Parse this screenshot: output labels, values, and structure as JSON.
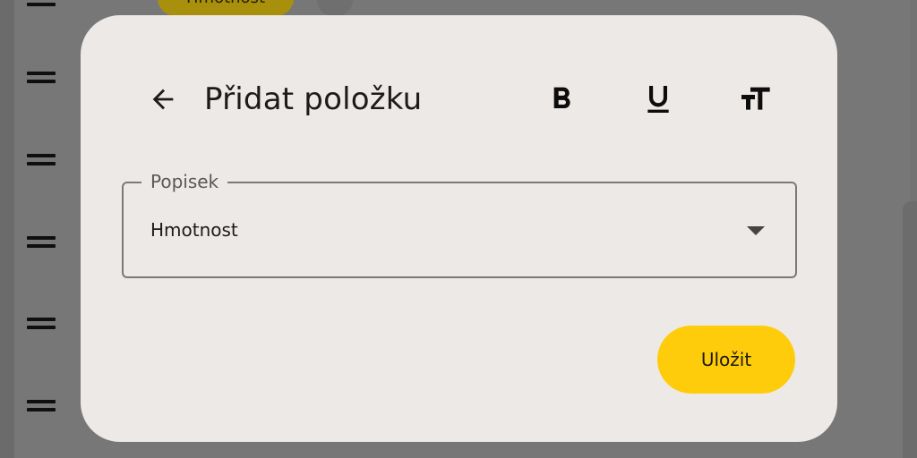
{
  "background": {
    "chip_label": "Hmotnost",
    "drag_handles": 5
  },
  "dialog": {
    "title": "Přidat položku",
    "back_icon": "arrow-back-icon",
    "toolbar": {
      "bold_icon": "format-bold-icon",
      "underline_icon": "format-underline-icon",
      "text_size_icon": "format-size-icon"
    },
    "field": {
      "label": "Popisek",
      "value": "Hmotnost"
    },
    "save_label": "Uložit"
  },
  "colors": {
    "accent": "#ffcc0b",
    "dialog_bg": "#ede9e6",
    "scrim": "#737373"
  }
}
